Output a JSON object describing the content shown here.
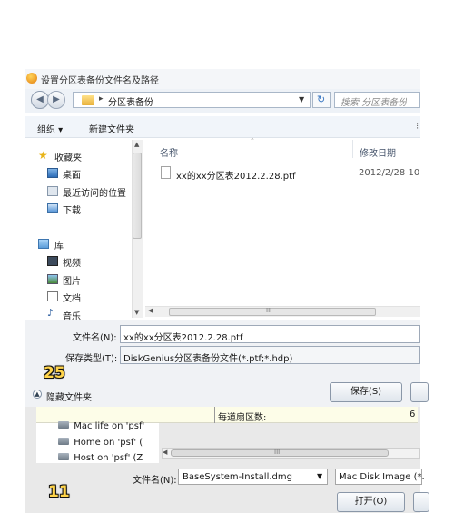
{
  "dialog": {
    "title": "设置分区表备份文件名及路径",
    "breadcrumb": "分区表备份",
    "search_placeholder": "搜索 分区表备份"
  },
  "toolbar": {
    "organize_label": "组织 ▾",
    "new_folder_label": "新建文件夹"
  },
  "nav": {
    "favorites": "收藏夹",
    "desktop": "桌面",
    "recent": "最近访问的位置",
    "downloads": "下载",
    "libraries": "库",
    "videos": "视频",
    "pictures": "图片",
    "documents": "文档",
    "music": "音乐"
  },
  "files": {
    "col_name": "名称",
    "col_date": "修改日期",
    "rows": [
      {
        "name": "xx的xx分区表2012.2.28.ptf",
        "date": "2012/2/28 10:"
      }
    ]
  },
  "form": {
    "filename_label": "文件名(N):",
    "filename_value": "xx的xx分区表2012.2.28.ptf",
    "filetype_label": "保存类型(T):",
    "filetype_value": "DiskGenius分区表备份文件(*.ptf;*.hdp)",
    "hide_folders_label": "隐藏文件夹",
    "save_label": "保存(S)"
  },
  "badges": {
    "top": "25",
    "bottom": "11"
  },
  "mac": {
    "info_label": "每道扇区数:",
    "info_value": "6",
    "items": [
      "Mac life on 'psf'",
      "Home on 'psf' (",
      "Host on 'psf' (Z"
    ],
    "filename_label": "文件名(N):",
    "filename_value": "BaseSystem-Install.dmg",
    "filetype_value": "Mac Disk Image (*.",
    "open_label": "打开(O)"
  }
}
